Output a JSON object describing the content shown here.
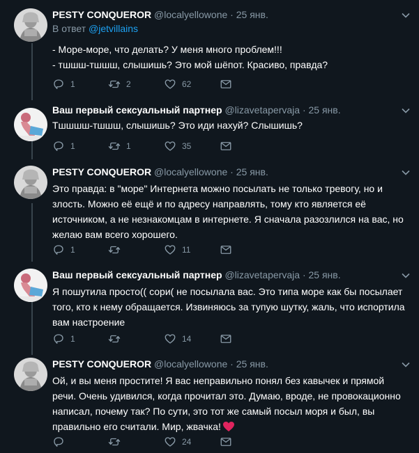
{
  "tweets": [
    {
      "name": "PESTY CONQUEROR",
      "handle": "@localyellowone",
      "sep": "·",
      "date": "25 янв.",
      "reply_prefix": "В ответ",
      "reply_user": "@jetvillains",
      "text": "- Море-море, что делать? У меня много проблем!!!\n- тшшш-тшшш, слышишь? Это мой шёпот. Красиво, правда?",
      "replies": "1",
      "retweets": "2",
      "likes": "62"
    },
    {
      "name": "Ваш первый сексуальный партнер",
      "handle": "@lizavetapervaja",
      "sep": "·",
      "date": "25 янв.",
      "text": "Тшшшш-тшшш, слышишь? Это иди нахуй? Слышишь?",
      "replies": "1",
      "retweets": "1",
      "likes": "35"
    },
    {
      "name": "PESTY CONQUEROR",
      "handle": "@localyellowone",
      "sep": "·",
      "date": "25 янв.",
      "text": "Это правда: в \"море\" Интернета можно посылать не только тревогу, но и злость. Можно её ещё и по адресу направлять, тому кто является её источником, а не незнакомцам в интернете. Я сначала разозлился на вас, но желаю вам всего хорошего.",
      "replies": "1",
      "retweets": "",
      "likes": "11"
    },
    {
      "name": "Ваш первый сексуальный партнер",
      "handle": "@lizavetapervaja",
      "sep": "·",
      "date": "25 янв.",
      "text": "Я пошутила просто(( сори( не посылала вас. Это типа море как бы посылает того, кто к нему обращается. Извиняюсь за тупую шутку, жаль, что испортила вам настроение",
      "replies": "1",
      "retweets": "",
      "likes": "14"
    },
    {
      "name": "PESTY CONQUEROR",
      "handle": "@localyellowone",
      "sep": "·",
      "date": "25 янв.",
      "text": "Ой, и вы меня простите! Я вас неправильно понял без кавычек и прямой речи. Очень удивился, когда прочитал это. Думаю, вроде, не провокационно написал, почему так? По сути, это тот же самый посыл моря и был, вы правильно его считали. Мир, жвачка!",
      "replies": "",
      "retweets": "",
      "likes": "24"
    }
  ],
  "icons": {
    "reply": "reply-icon",
    "retweet": "retweet-icon",
    "like": "heart-icon",
    "message": "envelope-icon",
    "more": "chevron-down-icon"
  },
  "colors": {
    "background": "#10171e",
    "text": "#ffffff",
    "muted": "#8899a6",
    "link": "#1da1f2",
    "divider": "#38444d",
    "heart_emoji": "#e0245e"
  }
}
